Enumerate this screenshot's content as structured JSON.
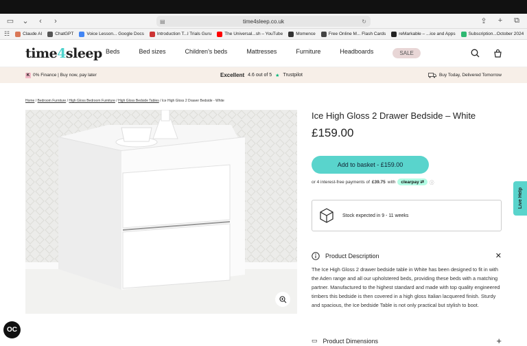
{
  "browser": {
    "url": "time4sleep.co.uk",
    "bookmarks": [
      {
        "label": "Claude AI",
        "color": "#d97757"
      },
      {
        "label": "ChatGPT",
        "color": "#555555"
      },
      {
        "label": "Voice Lesson... Google Docs",
        "color": "#4285f4"
      },
      {
        "label": "Introduction T...l Trials Guru",
        "color": "#cc3333"
      },
      {
        "label": "The Universal...sh – YouTube",
        "color": "#ff0000"
      },
      {
        "label": "Momence",
        "color": "#333333"
      },
      {
        "label": "Free Online M... Flash Cards",
        "color": "#444444"
      },
      {
        "label": "reMarkable – ...ice and Apps",
        "color": "#222222"
      },
      {
        "label": "Subscription...October 2024",
        "color": "#2eb872"
      }
    ]
  },
  "site": {
    "logo_a": "time",
    "logo_b": "4",
    "logo_c": "sleep",
    "nav": [
      "Beds",
      "Bed sizes",
      "Children's beds",
      "Mattresses",
      "Furniture",
      "Headboards"
    ],
    "sale": "SALE"
  },
  "promo": {
    "left": "0% Finance | Buy now, pay later",
    "excellent": "Excellent",
    "rating": "4.6 out of 5",
    "trustpilot": "Trustpilot",
    "right": "Buy Today, Delivered Tomorrow"
  },
  "breadcrumb": [
    "Home",
    "Bedroom Furniture",
    "High Gloss Bedroom Furniture",
    "High Gloss Bedside Tables",
    "Ice High Gloss 2 Drawer Bedside - White"
  ],
  "product": {
    "title": "Ice High Gloss 2 Drawer Bedside – White",
    "price": "£159.00",
    "basket_label": "Add to basket - £159.00",
    "clearpay_pre": "or 4 interest-free payments of",
    "clearpay_amount": "£39.75",
    "clearpay_with": "with",
    "clearpay_brand": "clearpay",
    "stock": "Stock expected in 9 - 11 weeks",
    "desc_heading": "Product Description",
    "description": "The Ice High Gloss 2 drawer bedside table in White has been designed to fit in with the Aden range and all our upholstered beds, providing these beds with a matching partner. Manufactured to the highest standard and made with top quality engineered timbers this bedside is then covered in a high gloss Italian lacquered finish. Sturdy and spacious, the Ice bedside Table is not only practical but stylish to boot.",
    "dims_heading": "Product Dimensions"
  },
  "help": "Live Help",
  "oc": "OC"
}
